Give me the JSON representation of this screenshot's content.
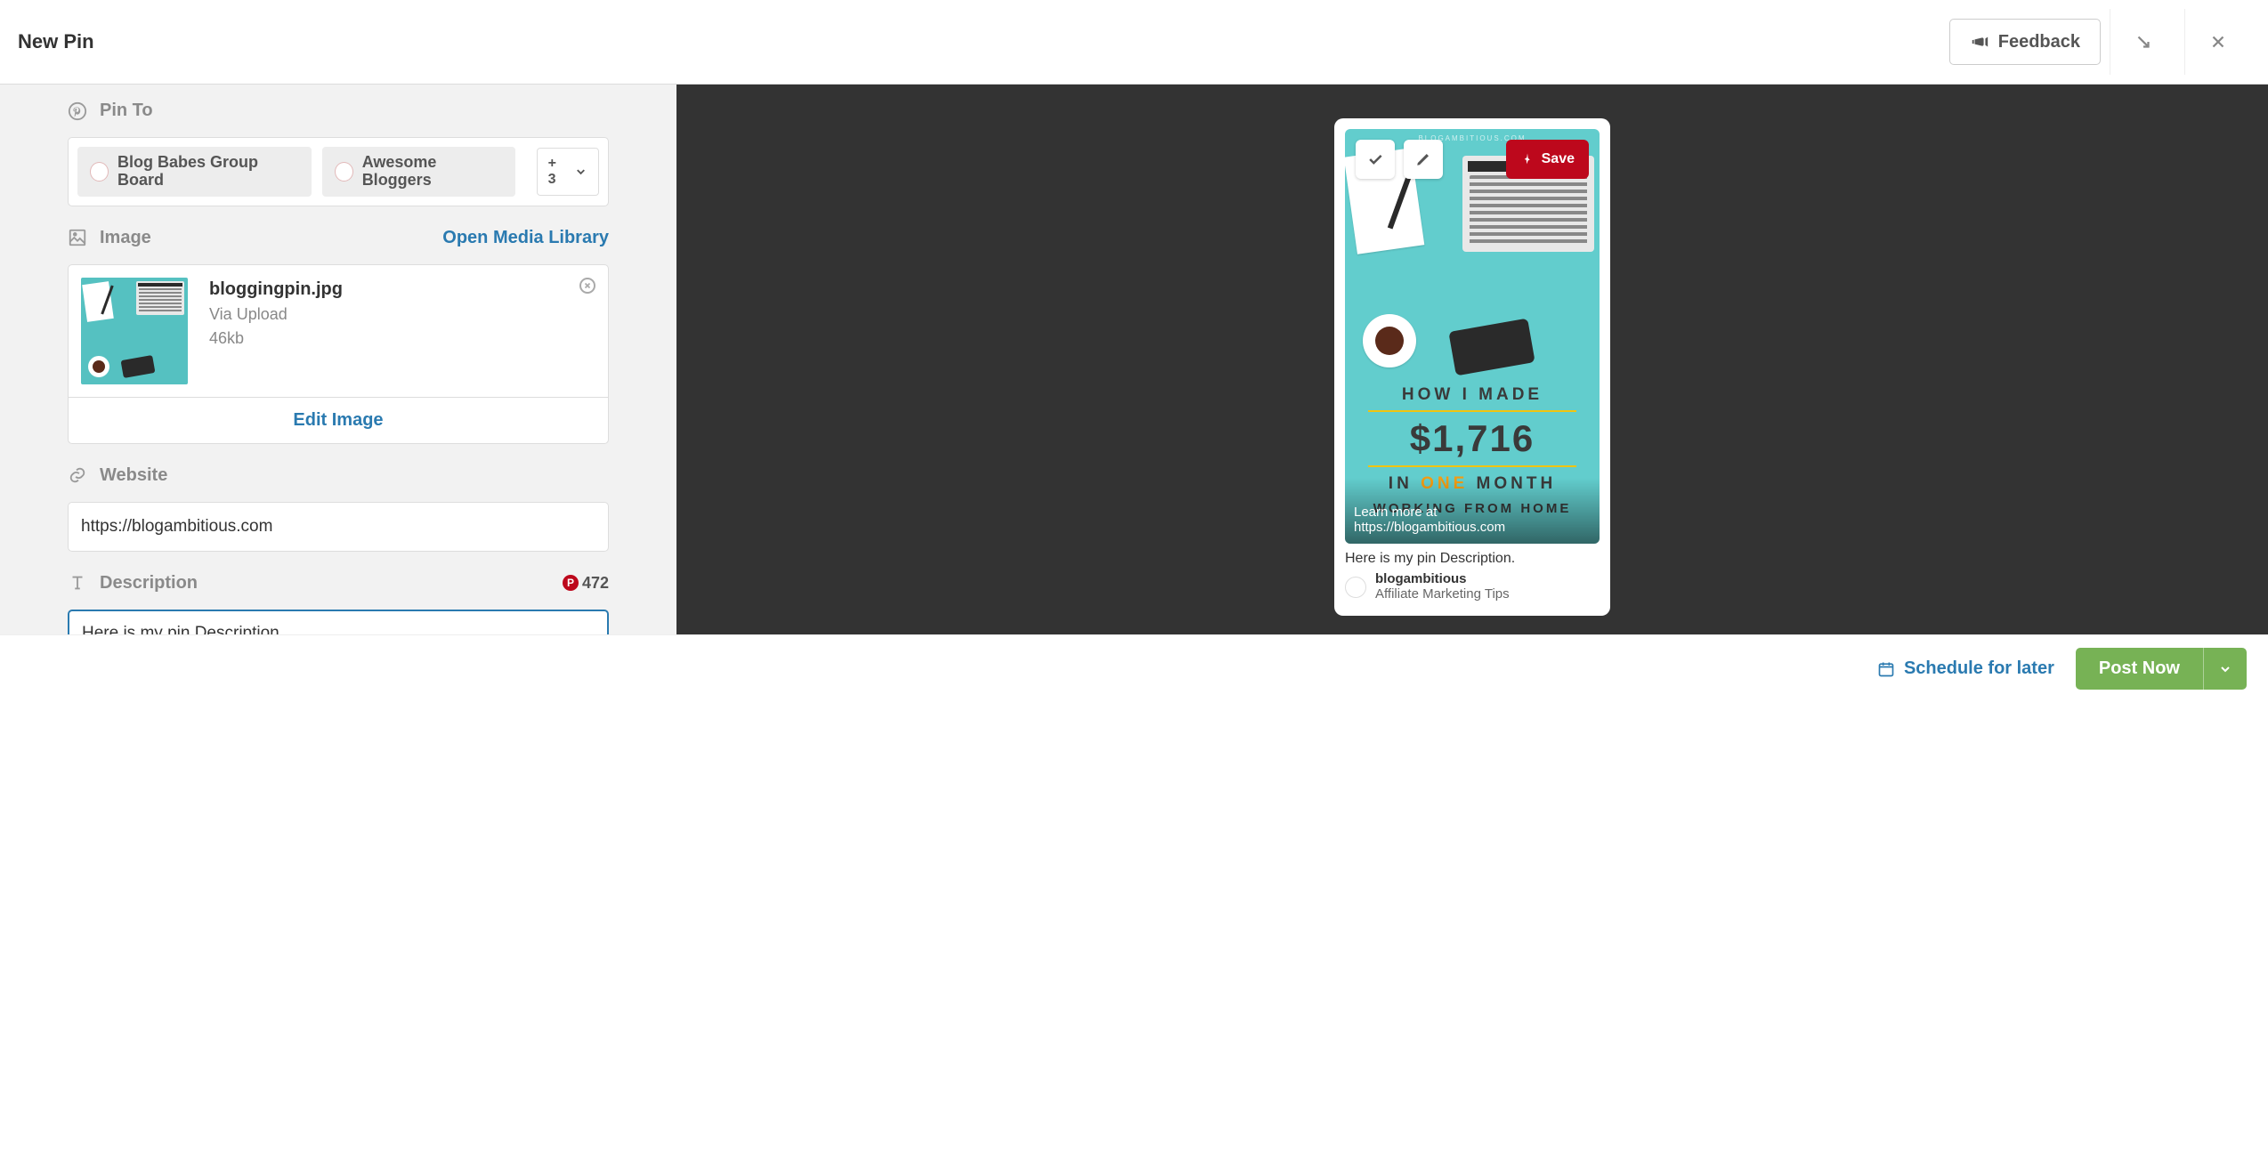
{
  "header": {
    "title": "New Pin",
    "feedback": "Feedback"
  },
  "sections": {
    "pinTo": {
      "label": "Pin To",
      "boards": [
        {
          "name": "Blog Babes Group Board"
        },
        {
          "name": "Awesome Bloggers"
        }
      ],
      "moreCount": "+ 3"
    },
    "image": {
      "label": "Image",
      "openMediaLibrary": "Open Media Library",
      "filename": "bloggingpin.jpg",
      "source": "Via Upload",
      "size": "46kb",
      "editImage": "Edit Image"
    },
    "website": {
      "label": "Website",
      "value": "https://blogambitious.com"
    },
    "description": {
      "label": "Description",
      "count": "472",
      "value": "Here is my pin Description."
    }
  },
  "preview": {
    "save": "Save",
    "watermark": "BLOGAMBITIOUS.COM",
    "line1": "HOW I MADE",
    "line2": "$1,716",
    "line3_in": "IN ",
    "line3_one": "ONE",
    "line3_month": " MONTH",
    "line4": "WORKING FROM HOME",
    "learnMore": "Learn more at https://blogambitious.com",
    "description": "Here is my pin Description.",
    "author": {
      "name": "blogambitious",
      "board": "Affiliate Marketing Tips"
    }
  },
  "footer": {
    "schedule": "Schedule for later",
    "postNow": "Post Now"
  }
}
